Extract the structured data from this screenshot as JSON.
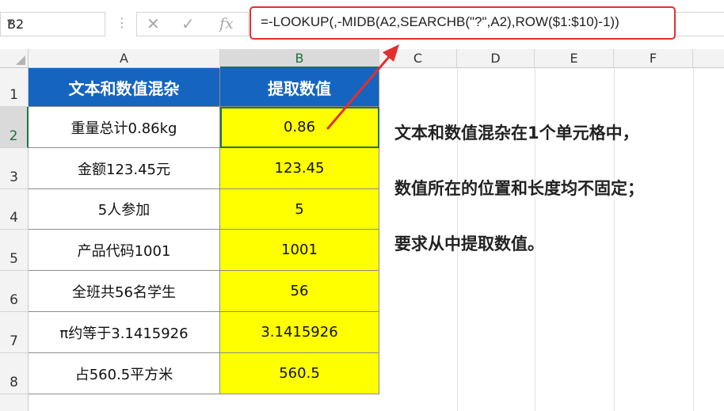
{
  "formula_bar": {
    "name_box": "B2",
    "name_box_dropdown": "▾",
    "dots": "⋮",
    "cancel_symbol": "✕",
    "enter_symbol": "✓",
    "fx_label": "fx",
    "formula": "=-LOOKUP(,-MIDB(A2,SEARCHB(\"?\",A2),ROW($1:$10)-1))"
  },
  "columns": [
    "A",
    "B",
    "C",
    "D",
    "E",
    "F"
  ],
  "rows": [
    "1",
    "2",
    "3",
    "4",
    "5",
    "6",
    "7",
    "8"
  ],
  "table": {
    "headers": [
      "文本和数值混杂",
      "提取数值"
    ],
    "data": [
      [
        "重量总计0.86kg",
        "0.86"
      ],
      [
        "金额123.45元",
        "123.45"
      ],
      [
        "5人参加",
        "5"
      ],
      [
        "产品代码1001",
        "1001"
      ],
      [
        "全班共56名学生",
        "56"
      ],
      [
        "π约等于3.1415926",
        "3.1415926"
      ],
      [
        "占560.5平方米",
        "560.5"
      ]
    ]
  },
  "notes": [
    "文本和数值混杂在1个单元格中，",
    "数值所在的位置和长度均不固定；",
    "要求从中提取数值。"
  ],
  "colors": {
    "header_fill": "#1565c0",
    "result_fill": "#ffff00",
    "highlight_border": "#e23030",
    "selection": "#217346"
  }
}
